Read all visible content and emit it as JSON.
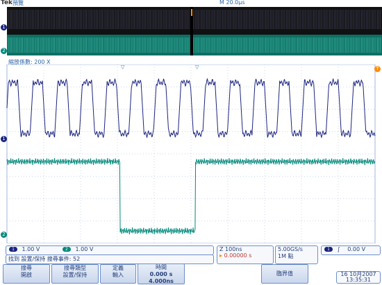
{
  "header": {
    "brand": "Tek",
    "mode": "預覽",
    "timebase": "M 20.0μs"
  },
  "zoom": {
    "factor_label": "縮放係數: 200 X"
  },
  "channel_markers": {
    "ch1": "1",
    "ch2": "2",
    "trigger": "T"
  },
  "status": {
    "ch1_scale": "1.00 V",
    "ch2_scale": "1.00 V",
    "ch1_num": "1",
    "ch2_num": "2",
    "search_info": "找到 設置/保持 搜尋事件: 52",
    "zoom_scale": "Z 100ns",
    "zoom_position": "0.00000 s",
    "sample_rate": "5.00GS/s",
    "record_length": "1M 點",
    "trig_source": "1",
    "trig_slope": "∫",
    "trig_level": "0.00 V"
  },
  "buttons": {
    "search": [
      "搜尋",
      "開啟"
    ],
    "search_type": [
      "搜尋類型",
      "設置/保持"
    ],
    "define_input": [
      "定義",
      "輸入"
    ],
    "time": [
      "時間",
      "0.000 s",
      "4.000ns"
    ],
    "threshold": "臨界值"
  },
  "datetime": {
    "date": "16 10月2007",
    "time": "13:35:31"
  },
  "colors": {
    "ch1": "#1a237e",
    "ch2": "#00897b",
    "ui_blue": "#2c63a8",
    "trigger": "#ff8c00"
  }
}
